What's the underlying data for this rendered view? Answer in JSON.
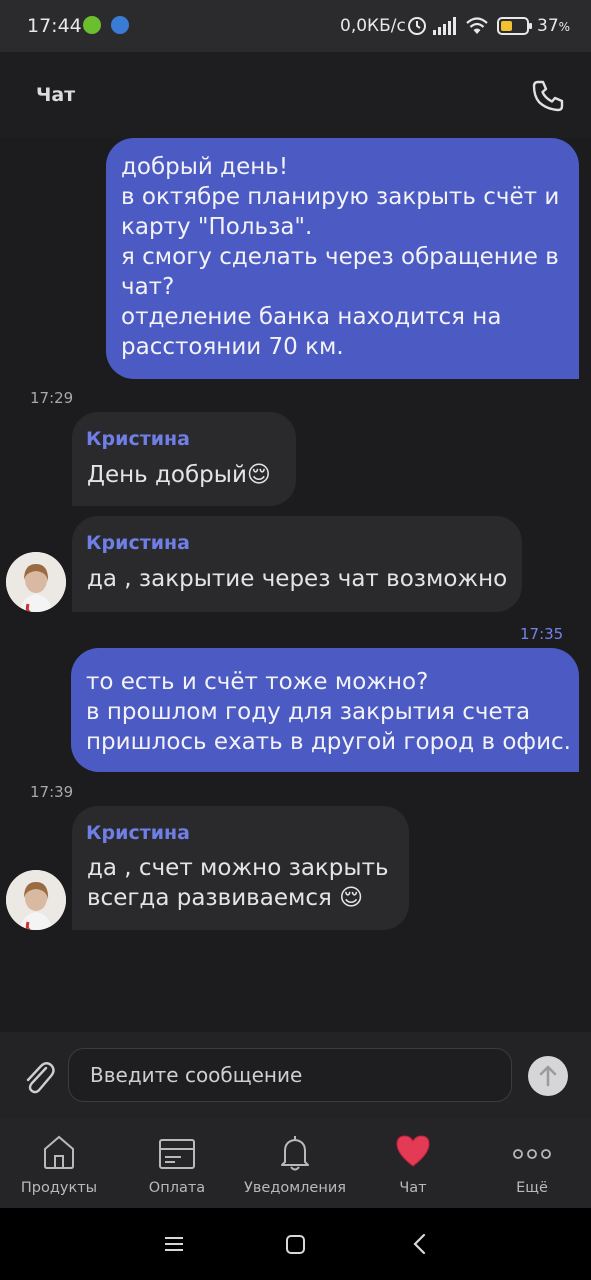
{
  "status_bar": {
    "time": "17:44",
    "network_speed": "0,0КБ/с",
    "battery": "37",
    "battery_unit": "%"
  },
  "header": {
    "title": "Чат"
  },
  "messages": [
    {
      "direction": "out",
      "text": "добрый день!\nв октябре планирую закрыть счёт и карту \"Польза\".\nя смогу сделать через обращение в чат?\nотделение банка находится на расстоянии 70 км."
    },
    {
      "direction": "in",
      "time": "17:29",
      "sender": "Кристина",
      "text": "День добрый😌"
    },
    {
      "direction": "in",
      "sender": "Кристина",
      "text": "да , закрытие через чат возможно"
    },
    {
      "direction": "out",
      "time": "17:35",
      "text": "то есть и счёт тоже можно?\nв прошлом году для закрытия счета пришлось ехать в другой город в офис."
    },
    {
      "direction": "in",
      "time": "17:39",
      "sender": "Кристина",
      "text": "да , счет можно закрыть\nвсегда развиваемся 😌"
    }
  ],
  "input": {
    "placeholder": "Введите сообщение"
  },
  "tabs": [
    {
      "label": "Продукты",
      "icon": "home-icon"
    },
    {
      "label": "Оплата",
      "icon": "card-icon"
    },
    {
      "label": "Уведомления",
      "icon": "bell-icon"
    },
    {
      "label": "Чат",
      "icon": "heart-icon"
    },
    {
      "label": "Ещё",
      "icon": "more-icon"
    }
  ],
  "colors": {
    "accent": "#4c5bc4",
    "sender_name": "#6f7fe6",
    "incoming_bubble": "#2a2a2c",
    "active_tab_heart": "#e33a55"
  }
}
